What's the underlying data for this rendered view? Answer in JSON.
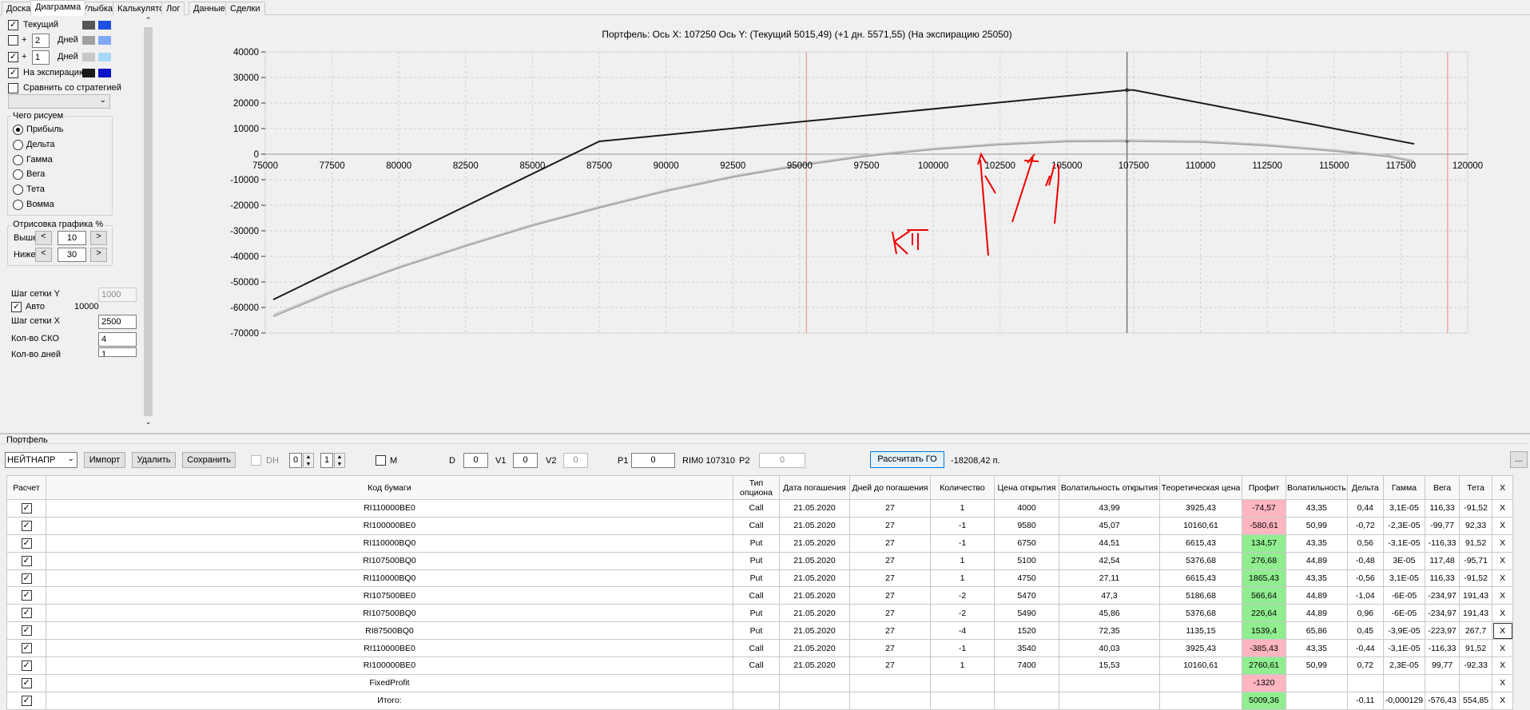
{
  "tabs": [
    {
      "label": "Доска"
    },
    {
      "label": "Диаграмма"
    },
    {
      "label": "Улыбка"
    },
    {
      "label": "Калькулятор"
    },
    {
      "label": "Лог"
    },
    {
      "label": "Данные"
    },
    {
      "label": "Сделки"
    }
  ],
  "left": {
    "current_label": "Текущий",
    "plus_sign": "+",
    "days_label": "Дней",
    "days1": "2",
    "days2": "1",
    "expiry_label": "На экспирацию",
    "compare_label": "Сравнить со стратегией",
    "what_title": "Чего рисуем",
    "radios": [
      "Прибыль",
      "Дельта",
      "Гамма",
      "Вега",
      "Тета",
      "Вомма"
    ],
    "draw_title": "Отрисовка графика %",
    "above_label": "Выше",
    "above_value": "10",
    "below_label": "Ниже",
    "below_value": "30",
    "btn_left": "<",
    "btn_right": ">",
    "grid_y_label": "Шаг сетки Y",
    "grid_y_value": "1000",
    "auto_label": "Авто",
    "auto_value": "10000",
    "grid_x_label": "Шаг сетки X",
    "grid_x_value": "2500",
    "sko_label": "Кол-во СКО",
    "sko_value": "4",
    "days_count_label": "Кол-во дней",
    "days_count_value": "1"
  },
  "colors": {
    "current_dark": "#555555",
    "current_light": "#1f4fe0",
    "d2_dark": "#a0a0a0",
    "d2_light": "#7fa8f5",
    "d1_dark": "#c8c8c8",
    "d1_light": "#a8d8f8",
    "exp_dark": "#1a1a1a",
    "exp_light": "#0a12c8",
    "profit_pos": "#90ee90",
    "profit_neg": "#ffb6c1"
  },
  "chart_data": {
    "type": "line",
    "title": "Портфель: Ось X:  107250 Ось Y:  (Текущий 5015,49)  (+1 дн. 5571,55)  (На экспирацию 25050)",
    "xlim": [
      75000,
      120000
    ],
    "ylim": [
      -70000,
      40000
    ],
    "xticks": [
      "75000",
      "77500",
      "80000",
      "82500",
      "85000",
      "87500",
      "90000",
      "92500",
      "95000",
      "97500",
      "100000",
      "102500",
      "105000",
      "107500",
      "110000",
      "112500",
      "115000",
      "117500",
      "120000"
    ],
    "yticks": [
      "40000",
      "30000",
      "20000",
      "10000",
      "0",
      "-10000",
      "-20000",
      "-30000",
      "-40000",
      "-50000",
      "-60000",
      "-70000"
    ],
    "grid": true,
    "cursor_x": 107250,
    "red_lines_x": [
      95250,
      119250
    ],
    "series": [
      {
        "x": [
          75300,
          87500,
          107250,
          107500,
          118000
        ],
        "y": [
          -56900,
          5000,
          25050,
          25050,
          4000
        ],
        "color": "#1a1a1a"
      },
      {
        "x": [
          75300,
          77500,
          80000,
          82500,
          85000,
          87500,
          90000,
          92500,
          95000,
          97500,
          100000,
          102500,
          105000,
          107250,
          110000,
          112500,
          115000,
          117000,
          118000
        ],
        "y": [
          -63500,
          -54000,
          -44500,
          -36000,
          -28000,
          -21000,
          -14500,
          -9000,
          -4500,
          -800,
          1800,
          3700,
          4900,
          5015,
          4700,
          3300,
          1200,
          -900,
          -3000
        ],
        "color": "#a0a0a0"
      },
      {
        "x": [
          75300,
          77500,
          80000,
          82500,
          85000,
          87500,
          90000,
          92500,
          95000,
          97500,
          100000,
          102500,
          105000,
          107250,
          110000,
          112500,
          115000,
          117000,
          118000
        ],
        "y": [
          -62800,
          -53400,
          -44000,
          -35500,
          -27500,
          -20500,
          -14000,
          -8500,
          -4000,
          -300,
          2300,
          4200,
          5400,
          5571,
          5200,
          3800,
          1700,
          -400,
          -2500
        ],
        "color": "#c8c8c8"
      }
    ]
  },
  "bottom": {
    "portfolio_label": "Портфель",
    "strategy_select": "НЕЙТНАПР",
    "import_btn": "Импорт",
    "delete_btn": "Удалить",
    "save_btn": "Сохранить",
    "dh_label": "DH",
    "dh_val1": "0",
    "dh_val2": "1",
    "m_label": "M",
    "d_label": "D",
    "d_value": "0",
    "v1_label": "V1",
    "v1_value": "0",
    "v2_label": "V2",
    "v2_value": "0",
    "p1_label": "P1",
    "p1_value": "0",
    "rim_label": "RIM0 107310",
    "p2_label": "P2",
    "p2_value": "0",
    "calc_btn": "Рассчитать ГО",
    "go_value": "-18208,42 п.",
    "more_btn": "..."
  },
  "table": {
    "headers": [
      "Расчет",
      "Код бумаги",
      "Тип опциона",
      "Дата погашения",
      "Дней до погашения",
      "Количество",
      "Цена открытия",
      "Волатильность открытия",
      "Теоретическая цена",
      "Профит",
      "Волатильность",
      "Дельта",
      "Гамма",
      "Вега",
      "Тета",
      "X"
    ],
    "rows": [
      {
        "code": "RI110000BE0",
        "type": "Call",
        "date": "21.05.2020",
        "days": "27",
        "qty": "1",
        "open": "4000",
        "vol_open": "43,99",
        "theor": "3925,43",
        "profit": "-74,57",
        "vol": "43,35",
        "delta": "0,44",
        "gamma": "3,1E-05",
        "vega": "116,33",
        "theta": "-91,52",
        "x": "X"
      },
      {
        "code": "RI100000BE0",
        "type": "Call",
        "date": "21.05.2020",
        "days": "27",
        "qty": "-1",
        "open": "9580",
        "vol_open": "45,07",
        "theor": "10160,61",
        "profit": "-580,61",
        "vol": "50,99",
        "delta": "-0,72",
        "gamma": "-2,3E-05",
        "vega": "-99,77",
        "theta": "92,33",
        "x": "X"
      },
      {
        "code": "RI110000BQ0",
        "type": "Put",
        "date": "21.05.2020",
        "days": "27",
        "qty": "-1",
        "open": "6750",
        "vol_open": "44,51",
        "theor": "6615,43",
        "profit": "134,57",
        "vol": "43,35",
        "delta": "0,56",
        "gamma": "-3,1E-05",
        "vega": "-116,33",
        "theta": "91,52",
        "x": "X"
      },
      {
        "code": "RI107500BQ0",
        "type": "Put",
        "date": "21.05.2020",
        "days": "27",
        "qty": "1",
        "open": "5100",
        "vol_open": "42,54",
        "theor": "5376,68",
        "profit": "276,68",
        "vol": "44,89",
        "delta": "-0,48",
        "gamma": "3E-05",
        "vega": "117,48",
        "theta": "-95,71",
        "x": "X"
      },
      {
        "code": "RI110000BQ0",
        "type": "Put",
        "date": "21.05.2020",
        "days": "27",
        "qty": "1",
        "open": "4750",
        "vol_open": "27,11",
        "theor": "6615,43",
        "profit": "1865,43",
        "vol": "43,35",
        "delta": "-0,56",
        "gamma": "3,1E-05",
        "vega": "116,33",
        "theta": "-91,52",
        "x": "X"
      },
      {
        "code": "RI107500BE0",
        "type": "Call",
        "date": "21.05.2020",
        "days": "27",
        "qty": "-2",
        "open": "5470",
        "vol_open": "47,3",
        "theor": "5186,68",
        "profit": "566,64",
        "vol": "44,89",
        "delta": "-1,04",
        "gamma": "-6E-05",
        "vega": "-234,97",
        "theta": "191,43",
        "x": "X"
      },
      {
        "code": "RI107500BQ0",
        "type": "Put",
        "date": "21.05.2020",
        "days": "27",
        "qty": "-2",
        "open": "5490",
        "vol_open": "45,86",
        "theor": "5376,68",
        "profit": "226,64",
        "vol": "44,89",
        "delta": "0,96",
        "gamma": "-6E-05",
        "vega": "-234,97",
        "theta": "191,43",
        "x": "X"
      },
      {
        "code": "RI87500BQ0",
        "type": "Put",
        "date": "21.05.2020",
        "days": "27",
        "qty": "-4",
        "open": "1520",
        "vol_open": "72,35",
        "theor": "1135,15",
        "profit": "1539,4",
        "vol": "65,86",
        "delta": "0,45",
        "gamma": "-3,9E-05",
        "vega": "-223,97",
        "theta": "267,7",
        "x": "X"
      },
      {
        "code": "RI110000BE0",
        "type": "Call",
        "date": "21.05.2020",
        "days": "27",
        "qty": "-1",
        "open": "3540",
        "vol_open": "40,03",
        "theor": "3925,43",
        "profit": "-385,43",
        "vol": "43,35",
        "delta": "-0,44",
        "gamma": "-3,1E-05",
        "vega": "-116,33",
        "theta": "91,52",
        "x": "X"
      },
      {
        "code": "RI100000BE0",
        "type": "Call",
        "date": "21.05.2020",
        "days": "27",
        "qty": "1",
        "open": "7400",
        "vol_open": "15,53",
        "theor": "10160,61",
        "profit": "2760,61",
        "vol": "50,99",
        "delta": "0,72",
        "gamma": "2,3E-05",
        "vega": "99,77",
        "theta": "-92,33",
        "x": "X"
      },
      {
        "code": "FixedProfit",
        "type": "",
        "date": "",
        "days": "",
        "qty": "",
        "open": "",
        "vol_open": "",
        "theor": "",
        "profit": "-1320",
        "vol": "",
        "delta": "",
        "gamma": "",
        "vega": "",
        "theta": "",
        "x": "X"
      },
      {
        "code": "Итого:",
        "type": "",
        "date": "",
        "days": "",
        "qty": "",
        "open": "",
        "vol_open": "",
        "theor": "",
        "profit": "5009,36",
        "vol": "",
        "delta": "-0,11",
        "gamma": "-0,000129",
        "vega": "-576,43",
        "theta": "554,85",
        "x": "X"
      }
    ]
  }
}
